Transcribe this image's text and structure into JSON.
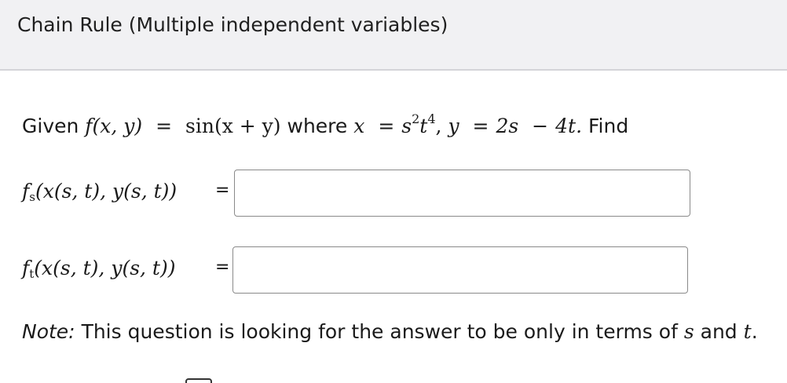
{
  "header": {
    "title": "Chain Rule (Multiple independent variables)"
  },
  "problem": {
    "given": "Given",
    "function": "f(x, y)",
    "equals": "=",
    "expression": "sin(x + y)",
    "where": "where",
    "x_var": "x",
    "x_eq": "=",
    "x_base": "s",
    "x_exp1": "2",
    "x_base2": "t",
    "x_exp2": "4",
    "comma": ",",
    "y_var": "y",
    "y_eq": "=",
    "y_expr_a": "2s",
    "minus": "−",
    "y_expr_b": "4t.",
    "find": "Find"
  },
  "answers": [
    {
      "label_main": "f",
      "label_sub": "s",
      "label_args": "(x(s, t), y(s, t))",
      "equals": "=",
      "value": ""
    },
    {
      "label_main": "f",
      "label_sub": "t",
      "label_args": "(x(s, t), y(s, t))",
      "equals": "=",
      "value": ""
    }
  ],
  "note": {
    "label": "Note:",
    "text_a": "This question is looking for the answer to be only in terms of",
    "var_s": "s",
    "and": "and",
    "var_t": "t",
    "period": "."
  }
}
